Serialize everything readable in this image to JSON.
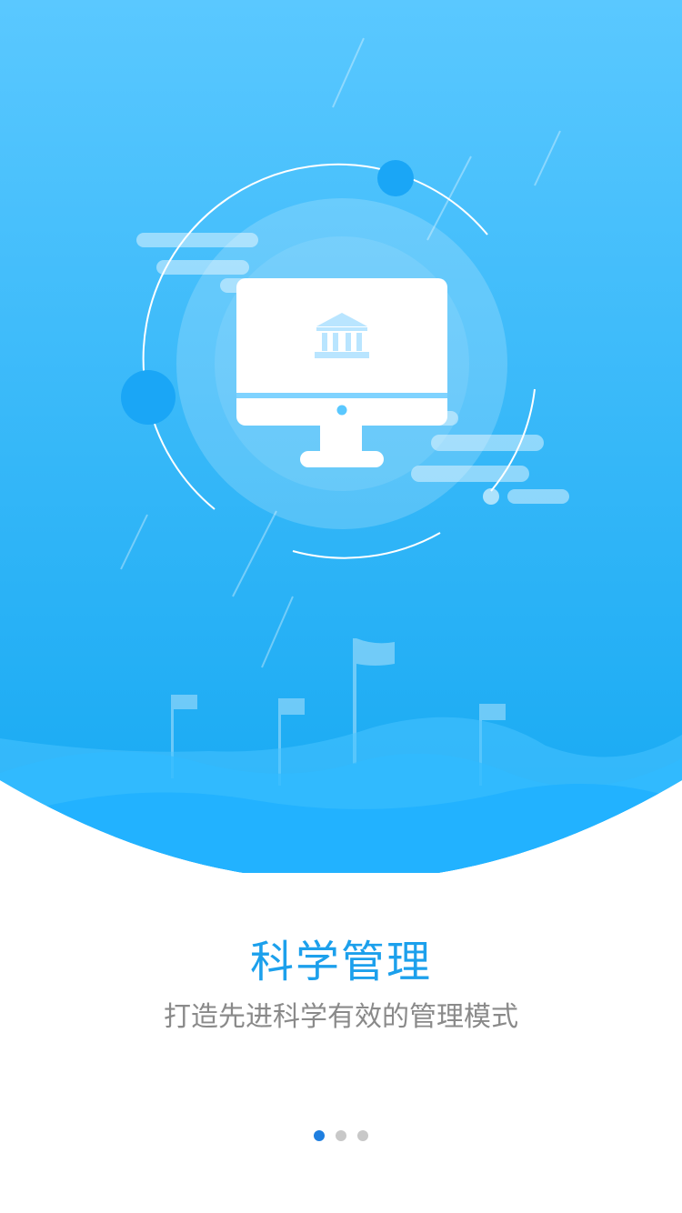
{
  "onboarding": {
    "title": "科学管理",
    "subtitle": "打造先进科学有效的管理模式"
  },
  "pager": {
    "total": 3,
    "active_index": 0
  },
  "illustration": {
    "subject_icons": [
      "monitor-icon",
      "bank-building-icon",
      "flag-icon",
      "cloud-icon"
    ]
  },
  "colors": {
    "hero_top": "#5ac8ff",
    "hero_bottom": "#16aaf2",
    "title": "#1ca0ec",
    "subtitle": "#8a8a8a",
    "dot_active": "#1f7fe0",
    "dot_inactive": "#c8c8c8"
  }
}
